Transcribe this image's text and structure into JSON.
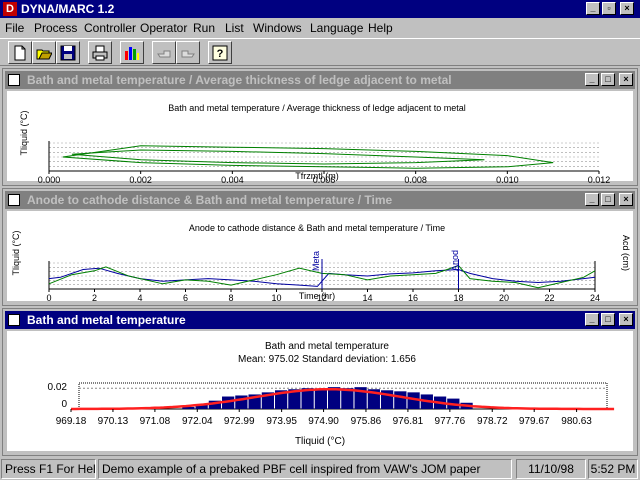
{
  "app": {
    "title": "DYNA/MARC 1.2"
  },
  "menu": [
    "File",
    "Process",
    "Controller",
    "Operator",
    "Run",
    "List",
    "Windows",
    "Language",
    "Help"
  ],
  "toolbar": {
    "buttons": [
      "new-icon",
      "open-icon",
      "save-icon",
      "print-icon",
      "chart-icon",
      "hand-back-icon",
      "hand-forward-icon",
      "help-icon"
    ]
  },
  "windows": {
    "w1": {
      "title": "Bath and metal temperature / Average thickness of ledge adjacent to metal",
      "chart_title": "Bath and metal temperature / Average thickness of ledge adjacent to metal",
      "xlabel": "Tfrzmtl (m)",
      "ylabel": "Tliquid (°C)",
      "xticks": [
        "0.000",
        "0.002",
        "0.004",
        "0.006",
        "0.008",
        "0.010",
        "0.012"
      ]
    },
    "w2": {
      "title": "Anode to cathode distance & Bath and metal temperature / Time",
      "chart_title": "Anode to cathode distance & Bath and metal temperature / Time",
      "xlabel": "Time (hr)",
      "ylabel_left": "Tliquid (°C)",
      "ylabel_right": "Acd (cm)",
      "xticks": [
        "0",
        "2",
        "4",
        "6",
        "8",
        "10",
        "12",
        "14",
        "16",
        "18",
        "20",
        "22",
        "24"
      ],
      "markers": [
        "Meta",
        "Anod"
      ]
    },
    "w3": {
      "title": "Bath and metal temperature",
      "chart_title": "Bath and metal temperature",
      "stats": "Mean: 975.02 Standard deviation: 1.656",
      "xlabel": "Tliquid (°C)",
      "yticks": [
        "0.02",
        "0"
      ],
      "xticks": [
        "969.18",
        "970.13",
        "971.08",
        "972.04",
        "972.99",
        "973.95",
        "974.90",
        "975.86",
        "976.81",
        "977.76",
        "978.72",
        "979.67",
        "980.63"
      ]
    }
  },
  "chart_data": [
    {
      "type": "line",
      "title": "Bath and metal temperature / Average thickness of ledge adjacent to metal",
      "xlabel": "Tfrzmtl (m)",
      "ylabel": "Tliquid (°C)",
      "xlim": [
        0.0,
        0.012
      ],
      "grid": true,
      "series": [
        {
          "x": [
            0.0003,
            0.002,
            0.004,
            0.006,
            0.008,
            0.01,
            0.011,
            0.01,
            0.008,
            0.006,
            0.004,
            0.002,
            0.0003
          ],
          "y": [
            0.5,
            0.9,
            0.85,
            0.8,
            0.7,
            0.55,
            0.3,
            0.15,
            0.1,
            0.15,
            0.2,
            0.3,
            0.5
          ]
        },
        {
          "x": [
            0.0005,
            0.002,
            0.004,
            0.006,
            0.008,
            0.0095,
            0.008,
            0.006,
            0.004,
            0.002,
            0.0005
          ],
          "y": [
            0.6,
            0.75,
            0.7,
            0.62,
            0.5,
            0.4,
            0.3,
            0.25,
            0.3,
            0.4,
            0.6
          ]
        }
      ],
      "colors": [
        "#008000"
      ]
    },
    {
      "type": "line",
      "title": "Anode to cathode distance & Bath and metal temperature / Time",
      "xlabel": "Time (hr)",
      "ylabel": "Tliquid (°C)",
      "ylabel_right": "Acd (cm)",
      "xlim": [
        0,
        24
      ],
      "series": [
        {
          "color": "#0000a0",
          "x": [
            0,
            0.5,
            1.5,
            2.2,
            3,
            4,
            5,
            6,
            7,
            8,
            9,
            10,
            11,
            11.8,
            12.3,
            13,
            14,
            15,
            16,
            17,
            18,
            18.5,
            19.5,
            20.5,
            21.5,
            22.5,
            23.5,
            24
          ],
          "y": [
            0.4,
            0.45,
            0.75,
            0.8,
            0.6,
            0.4,
            0.3,
            0.35,
            0.4,
            0.35,
            0.3,
            0.2,
            0.15,
            0.1,
            0.6,
            0.55,
            0.5,
            0.58,
            0.62,
            0.7,
            0.75,
            0.6,
            0.4,
            0.3,
            0.25,
            0.3,
            0.4,
            0.45
          ]
        },
        {
          "color": "#008000",
          "x": [
            0,
            1,
            2,
            2.5,
            3.5,
            5,
            6,
            7,
            8,
            9,
            10,
            11,
            12,
            13,
            14,
            15,
            16,
            17,
            18,
            18.5,
            19.5,
            20.5,
            21.5,
            22.5,
            23.5,
            24
          ],
          "y": [
            0.2,
            0.55,
            0.7,
            0.85,
            0.5,
            0.2,
            0.35,
            0.3,
            0.15,
            0.35,
            0.55,
            0.8,
            0.6,
            0.55,
            0.35,
            0.5,
            0.55,
            0.6,
            0.9,
            0.4,
            0.3,
            0.25,
            0.05,
            0.25,
            0.45,
            0.7
          ]
        }
      ]
    },
    {
      "type": "bar",
      "title": "Bath and metal temperature",
      "subtitle": "Mean: 975.02 Standard deviation: 1.656",
      "xlabel": "Tliquid (°C)",
      "xlim": [
        969.18,
        981.5
      ],
      "ylim": [
        0,
        0.025
      ],
      "mean": 975.02,
      "std": 1.656,
      "bins_x": [
        971.7,
        972.0,
        972.3,
        972.6,
        972.9,
        973.2,
        973.5,
        973.8,
        974.1,
        974.4,
        974.7,
        975.0,
        975.3,
        975.6,
        975.9,
        976.2,
        976.5,
        976.8,
        977.1,
        977.4,
        977.7,
        978.0
      ],
      "values": [
        0.002,
        0.004,
        0.008,
        0.012,
        0.013,
        0.014,
        0.016,
        0.018,
        0.019,
        0.02,
        0.019,
        0.021,
        0.02,
        0.021,
        0.019,
        0.018,
        0.017,
        0.016,
        0.014,
        0.012,
        0.01,
        0.006
      ],
      "bar_color": "#000080",
      "curve_color": "#ff2020"
    }
  ],
  "status": {
    "help": "Press F1 For Help",
    "message": "Demo example of a prebaked PBF cell inspired from VAW's JOM paper",
    "date": "11/10/98",
    "time": "5:52 PM"
  }
}
